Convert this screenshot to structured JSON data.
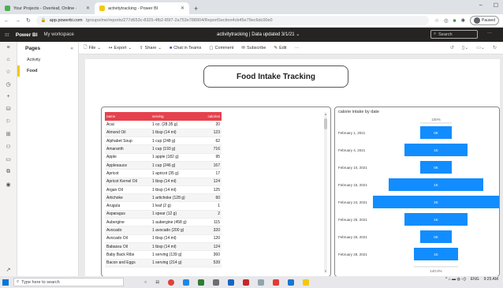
{
  "browser": {
    "tabs": [
      {
        "title": "Your Projects - Overleaf, Online ·",
        "color": "#4caf50",
        "active": false
      },
      {
        "title": "activitytracking - Power BI",
        "color": "#f2c811",
        "active": true
      }
    ],
    "new_tab_label": "+",
    "url_host": "app.powerbi.com",
    "url_path": "/groups/me/reports/277d653c-8325-4fb2-85f7-2a753e788904/ReportSection4cb45e79ec6dc00e0",
    "paused_label": "Paused"
  },
  "powerbi": {
    "brand": "Power BI",
    "workspace": "My workspace",
    "report_status": "activitytracking  |  Data updated 3/1/21",
    "search_placeholder": "Search"
  },
  "pages_pane": {
    "title": "Pages",
    "pages": [
      "Activity",
      "Food"
    ],
    "active_index": 1
  },
  "toolbar": {
    "file": "File",
    "export": "Export",
    "share": "Share",
    "chat": "Chat in Teams",
    "comment": "Comment",
    "subscribe": "Subscribe",
    "edit": "Edit",
    "more": "···"
  },
  "report": {
    "title": "Food Intake Tracking"
  },
  "food_table": {
    "columns": [
      "name",
      "serving",
      "calories"
    ],
    "rows": [
      [
        "Acai",
        "1 oz. (28.35 g)",
        "20"
      ],
      [
        "Almond Oil",
        "1 tbsp (14 ml)",
        "123"
      ],
      [
        "Alphabet Soup",
        "1 cup (248 g)",
        "62"
      ],
      [
        "Amaranth",
        "1 cup (193 g)",
        "716"
      ],
      [
        "Apple",
        "1 apple (182 g)",
        "95"
      ],
      [
        "Applesauce",
        "1 cup (246 g)",
        "167"
      ],
      [
        "Apricot",
        "1 apricot (35 g)",
        "17"
      ],
      [
        "Apricot Kernel Oil",
        "1 tbsp (14 ml)",
        "124"
      ],
      [
        "Argan Oil",
        "1 tbsp (14 ml)",
        "125"
      ],
      [
        "Artichoke",
        "1 artichoke (128 g)",
        "60"
      ],
      [
        "Arugula",
        "1 leaf (2 g)",
        "1"
      ],
      [
        "Asparagus",
        "1 spear (12 g)",
        "2"
      ],
      [
        "Aubergine",
        "1 aubergine (458 g)",
        "115"
      ],
      [
        "Avocado",
        "1 avocado (200 g)",
        "320"
      ],
      [
        "Avocado Oil",
        "1 tbsp (14 ml)",
        "120"
      ],
      [
        "Babassu Oil",
        "1 tbsp (14 ml)",
        "124"
      ],
      [
        "Baby Back Ribs",
        "1 serving (139 g)",
        "360"
      ],
      [
        "Bacon and Eggs",
        "1 serving (214 g)",
        "539"
      ]
    ]
  },
  "chart_data": {
    "type": "bar",
    "subtype": "funnel",
    "title": "calorie intake by date",
    "categories": [
      "February 1, 2021",
      "February 4, 2021",
      "February 10, 2021",
      "February 15, 2021",
      "February 24, 2021",
      "February 25, 2021",
      "February 26, 2021",
      "February 28, 2021"
    ],
    "values": [
      500,
      1000,
      500,
      1500,
      2000,
      1000,
      500,
      700
    ],
    "data_labels": [
      "0K",
      "1K",
      "0K",
      "1K",
      "2K",
      "1K",
      "0K",
      "1K"
    ],
    "top_label": "100%",
    "bottom_label": "140.0%",
    "color": "#118dff"
  },
  "taskbar": {
    "search_placeholder": "Type here to search",
    "time": "9:25 AM",
    "lang": "ENG"
  }
}
